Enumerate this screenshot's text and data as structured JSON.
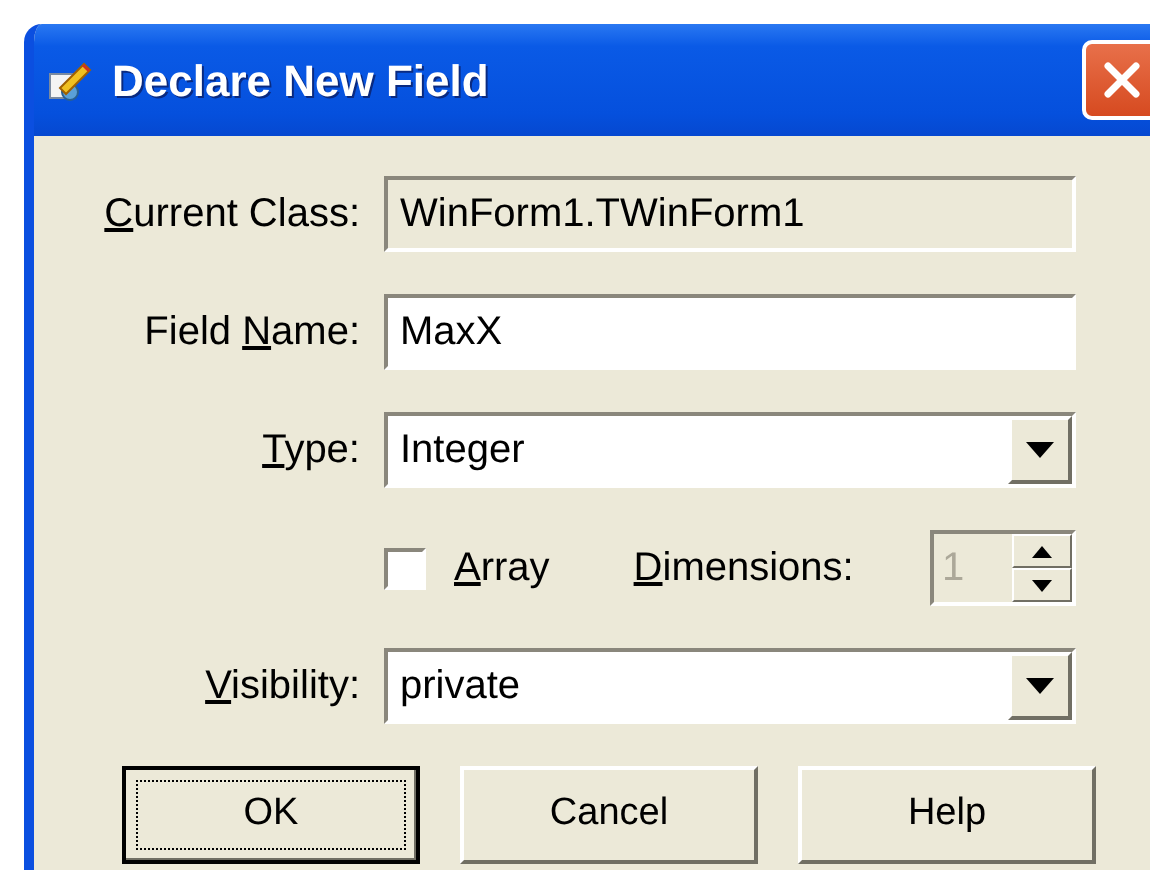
{
  "window": {
    "title": "Declare New Field"
  },
  "fields": [
    {
      "kind": "text",
      "label": {
        "key": "C",
        "post": "urrent Class:"
      },
      "value": "WinForm1.TWinForm1",
      "disabled": true
    },
    {
      "kind": "text",
      "label": {
        "pre": "Field ",
        "key": "N",
        "post": "ame:"
      },
      "value": "MaxX",
      "disabled": false
    },
    {
      "kind": "combo",
      "label": {
        "key": "T",
        "post": "ype:"
      },
      "value": "Integer"
    },
    {
      "kind": "array",
      "checkbox": {
        "label": {
          "key": "A",
          "post": "rray"
        },
        "checked": false
      },
      "spinner": {
        "label": {
          "key": "D",
          "post": "imensions:"
        },
        "value": "1",
        "disabled": true
      }
    },
    {
      "kind": "combo",
      "label": {
        "key": "V",
        "post": "isibility:"
      },
      "value": "private"
    }
  ],
  "buttons": [
    {
      "label": "OK",
      "default": true
    },
    {
      "label": "Cancel",
      "default": false
    },
    {
      "label": "Help",
      "default": false
    }
  ]
}
